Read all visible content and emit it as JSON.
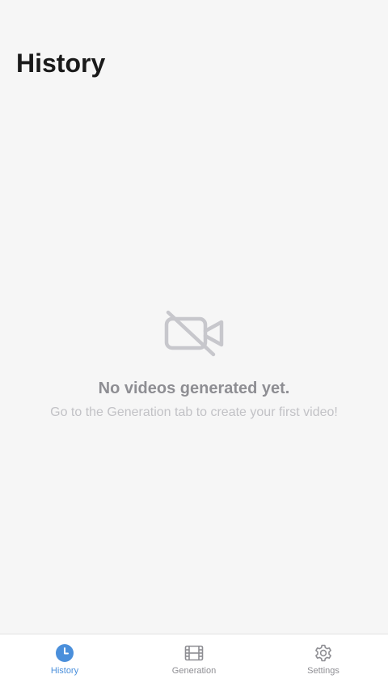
{
  "header": {
    "title": "History"
  },
  "empty_state": {
    "icon": "video-off-icon",
    "title": "No videos generated yet.",
    "subtitle": "Go to the Generation tab to create your first video!"
  },
  "tabbar": {
    "active": "History",
    "items": [
      {
        "label": "History",
        "icon": "clock-icon"
      },
      {
        "label": "Generation",
        "icon": "film-icon"
      },
      {
        "label": "Settings",
        "icon": "gear-icon"
      }
    ]
  },
  "colors": {
    "accent": "#4a8fdb",
    "inactive": "#8e8e93",
    "background": "#f6f6f6"
  }
}
